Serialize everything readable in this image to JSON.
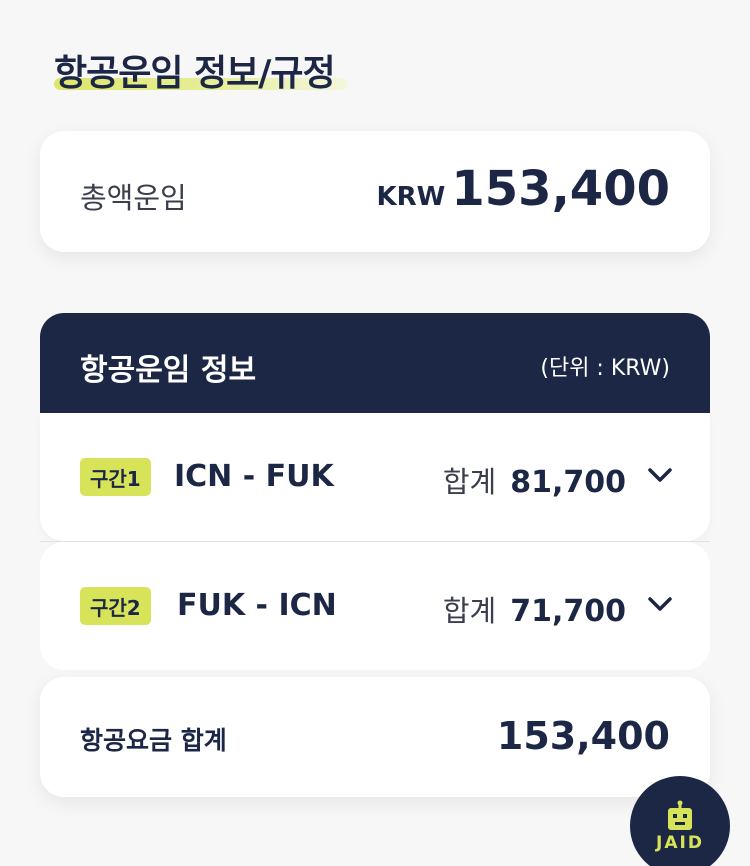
{
  "page": {
    "title": "항공운임 정보/규정"
  },
  "total": {
    "label": "총액운임",
    "currency": "KRW",
    "amount": "153,400"
  },
  "info": {
    "title": "항공운임 정보",
    "unit": "(단위 : KRW)"
  },
  "segments": [
    {
      "badge": "구간1",
      "route": "ICN - FUK",
      "sum_label": "합계",
      "sum_value": "81,700"
    },
    {
      "badge": "구간2",
      "route": "FUK - ICN",
      "sum_label": "합계",
      "sum_value": "71,700"
    }
  ],
  "fare_total": {
    "label": "항공요금 합계",
    "amount": "153,400"
  },
  "assistant": {
    "label": "JAID"
  },
  "colors": {
    "navy": "#1c2645",
    "accent": "#d7e45a",
    "background": "#f7f7f7"
  }
}
